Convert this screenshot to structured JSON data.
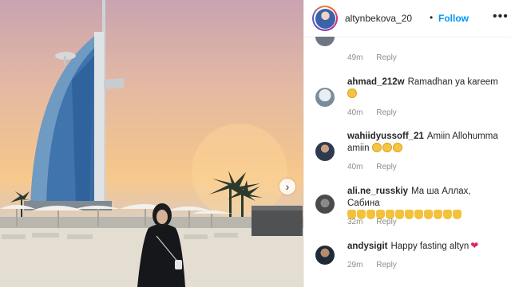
{
  "post": {
    "username": "altynbekova_20",
    "separator": "•",
    "follow_label": "Follow",
    "more_icon": "more-icon",
    "next_icon": "chevron-right-icon"
  },
  "comments": [
    {
      "user": "",
      "text": "",
      "time": "49m",
      "reply": "Reply"
    },
    {
      "user": "ahmad_212w",
      "text": "Ramadhan ya kareem",
      "emojis": 1,
      "time": "40m",
      "reply": "Reply"
    },
    {
      "user": "wahiidyussoff_21",
      "text": "Amiin Allohumma amiin",
      "emojis": 3,
      "time": "40m",
      "reply": "Reply"
    },
    {
      "user": "ali.ne_russkiy",
      "text": "Ма ша Аллах, Сабина",
      "praise": 12,
      "time": "32m",
      "reply": "Reply"
    },
    {
      "user": "andysigit",
      "text": "Happy fasting altyn",
      "heart": "❤",
      "time": "29m",
      "reply": "Reply"
    }
  ],
  "colors": {
    "link": "#0095f6",
    "meta": "#8e8e8e",
    "text": "#262626"
  }
}
